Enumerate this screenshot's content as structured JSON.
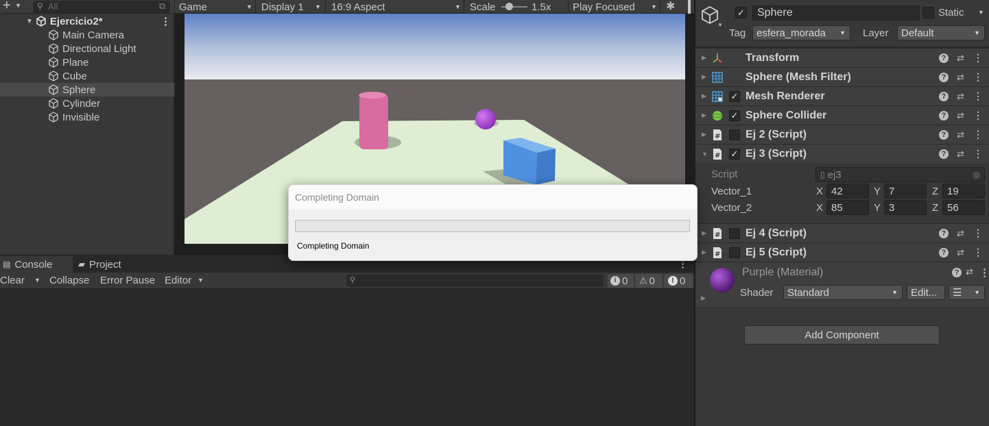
{
  "hierarchy": {
    "search_placeholder": "All",
    "scene": "Ejercicio2*",
    "items": [
      "Main Camera",
      "Directional Light",
      "Plane",
      "Cube",
      "Sphere",
      "Cylinder",
      "Invisible"
    ],
    "selected": "Sphere"
  },
  "game_toolbar": {
    "tab": "Game",
    "display": "Display 1",
    "aspect": "16:9 Aspect",
    "scale_label": "Scale",
    "scale_value": "1.5x",
    "play_mode": "Play Focused"
  },
  "console": {
    "tabs": [
      "Console",
      "Project"
    ],
    "clear": "Clear",
    "collapse": "Collapse",
    "error_pause": "Error Pause",
    "editor": "Editor",
    "counts": {
      "info": "0",
      "warn": "0",
      "error": "0"
    }
  },
  "inspector": {
    "object_name": "Sphere",
    "static_label": "Static",
    "tag_label": "Tag",
    "tag_value": "esfera_morada",
    "layer_label": "Layer",
    "layer_value": "Default",
    "components": [
      {
        "name": "Transform",
        "checkbox": "none",
        "icon": "transform-icon"
      },
      {
        "name": "Sphere (Mesh Filter)",
        "checkbox": "none",
        "icon": "mesh-filter-icon"
      },
      {
        "name": "Mesh Renderer",
        "checkbox": "checked",
        "icon": "mesh-renderer-icon"
      },
      {
        "name": "Sphere Collider",
        "checkbox": "checked",
        "icon": "sphere-collider-icon"
      },
      {
        "name": "Ej 2 (Script)",
        "checkbox": "unchecked",
        "icon": "script-icon"
      },
      {
        "name": "Ej 3 (Script)",
        "checkbox": "checked",
        "icon": "script-icon"
      }
    ],
    "ej3": {
      "script_label": "Script",
      "script_value": "ej3",
      "vector1_label": "Vector_1",
      "vector1": {
        "x": "42",
        "y": "7",
        "z": "19"
      },
      "vector2_label": "Vector_2",
      "vector2": {
        "x": "85",
        "y": "3",
        "z": "56"
      }
    },
    "components_after": [
      {
        "name": "Ej 4 (Script)",
        "checkbox": "unchecked",
        "icon": "script-icon"
      },
      {
        "name": "Ej 5 (Script)",
        "checkbox": "unchecked",
        "icon": "script-icon"
      }
    ],
    "material": {
      "name": "Purple (Material)",
      "shader_label": "Shader",
      "shader_value": "Standard",
      "edit_label": "Edit..."
    },
    "add_component": "Add Component"
  },
  "dialog": {
    "title": "Completing Domain",
    "message": "Completing Domain"
  }
}
